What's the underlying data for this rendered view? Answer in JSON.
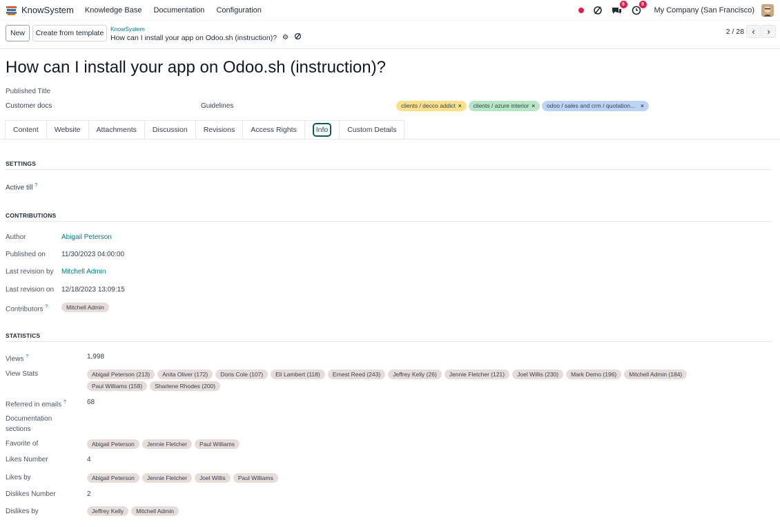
{
  "navbar": {
    "app_name": "KnowSystem",
    "menu": [
      "Knowledge Base",
      "Documentation",
      "Configuration"
    ],
    "chat_badge": "6",
    "activity_badge": "9",
    "company": "My Company (San Francisco)"
  },
  "control_panel": {
    "new_label": "New",
    "template_label": "Create from template",
    "breadcrumb_parent": "KnowSystem",
    "breadcrumb_current": "How can I install your app on Odoo.sh (instruction)?",
    "pager": "2 / 28"
  },
  "form": {
    "title": "How can I install your app on Odoo.sh (instruction)?",
    "published_title_label": "Published Title",
    "customer_docs": "Customer docs",
    "guidelines": "Guidelines",
    "tags": [
      {
        "label": "clients / decco addict",
        "color": "#fbe28a"
      },
      {
        "label": "clients / azure interior",
        "color": "#b6e6c3"
      },
      {
        "label": "odoo / sales and crm / quotation...",
        "color": "#bcd3f5"
      }
    ]
  },
  "tabs": [
    "Content",
    "Website",
    "Attachments",
    "Discussion",
    "Revisions",
    "Access Rights",
    "Info",
    "Custom Details"
  ],
  "settings": {
    "title": "SETTINGS",
    "active_till_label": "Active till"
  },
  "contributions": {
    "title": "CONTRIBUTIONS",
    "author_label": "Author",
    "author": "Abigail Peterson",
    "published_on_label": "Published on",
    "published_on": "11/30/2023 04:00:00",
    "last_revision_by_label": "Last revision by",
    "last_revision_by": "Mitchell Admin",
    "last_revision_on_label": "Last revision on",
    "last_revision_on": "12/18/2023 13:09:15",
    "contributors_label": "Contributors",
    "contributors": [
      "Mitchell Admin"
    ]
  },
  "statistics": {
    "title": "STATISTICS",
    "views_label": "Views",
    "views": "1,998",
    "view_stats_label": "View Stats",
    "view_stats": [
      "Abigail Peterson (213)",
      "Anita Oliver (172)",
      "Doris Cole (107)",
      "Eli Lambert (118)",
      "Ernest Reed (243)",
      "Jeffrey Kelly (26)",
      "Jennie Fletcher (121)",
      "Joel Willis (230)",
      "Mark Demo (196)",
      "Mitchell Admin (184)",
      "Paul Williams (158)",
      "Sharlene Rhodes (200)"
    ],
    "referred_label": "Referred in emails",
    "referred": "68",
    "doc_sections_label_1": "Documentation",
    "doc_sections_label_2": "sections",
    "favorite_label": "Favorite of",
    "favorite": [
      "Abigail Peterson",
      "Jennie Fletcher",
      "Paul Williams"
    ],
    "likes_number_label": "Likes Number",
    "likes_number": "4",
    "likes_by_label": "Likes by",
    "likes_by": [
      "Abigail Peterson",
      "Jennie Fletcher",
      "Joel Willis",
      "Paul Williams"
    ],
    "dislikes_number_label": "Dislikes Number",
    "dislikes_number": "2",
    "dislikes_by_label": "Dislikes by",
    "dislikes_by": [
      "Jeffrey Kelly",
      "Mitchell Admin"
    ]
  }
}
